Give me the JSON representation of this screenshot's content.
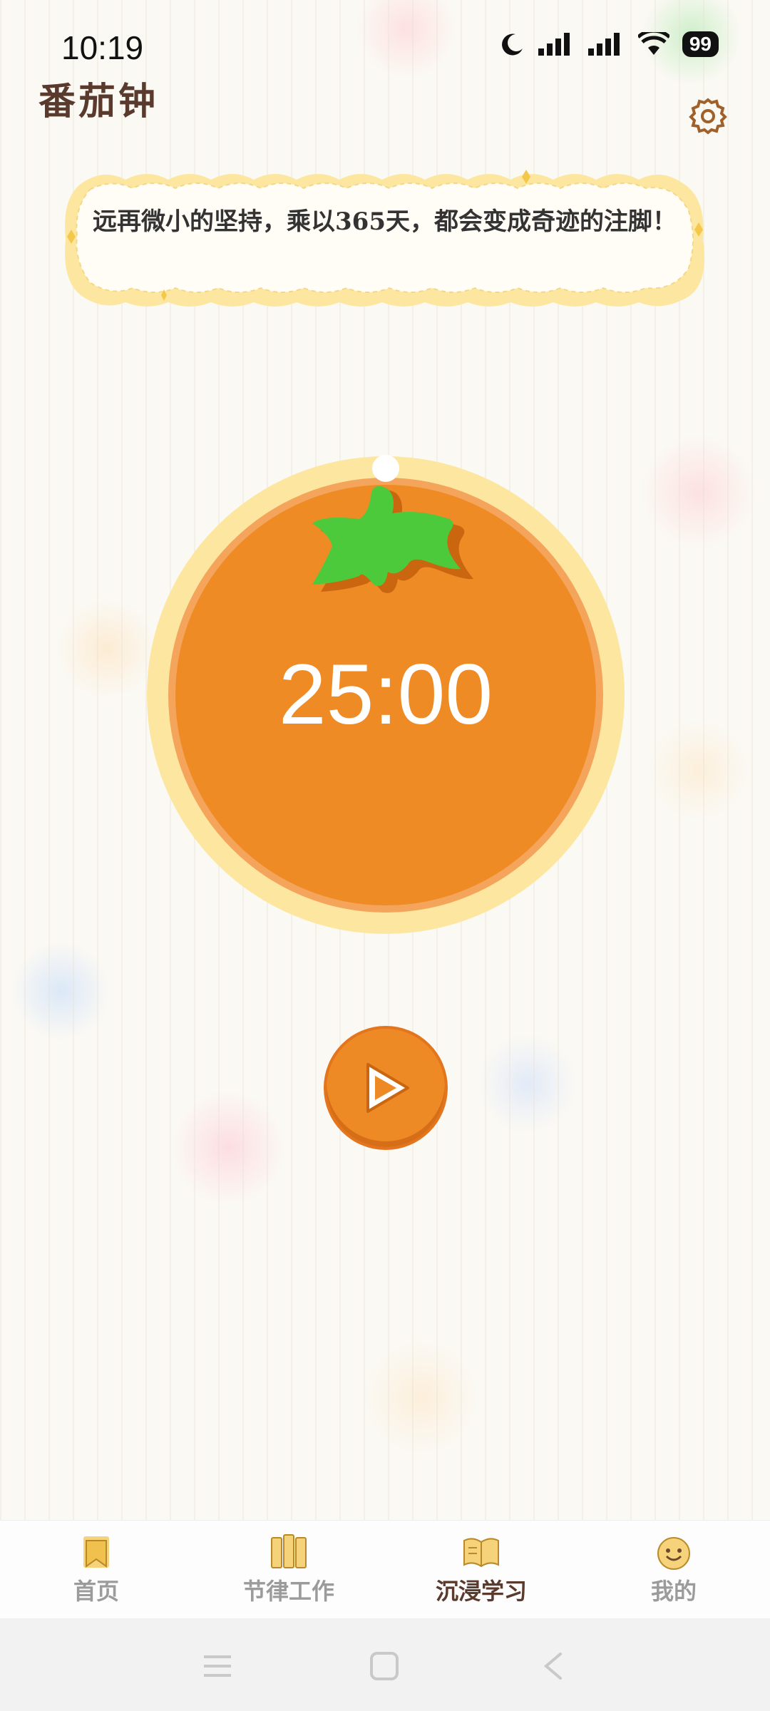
{
  "status_bar": {
    "time": "10:19",
    "battery": "99"
  },
  "header": {
    "title": "番茄钟",
    "settings_icon": "gear-icon"
  },
  "quote": {
    "text": "远再微小的坚持，乘以365天，都会变成奇迹的注脚！"
  },
  "timer": {
    "display": "25:00",
    "progress": 0
  },
  "controls": {
    "play_icon": "play-icon"
  },
  "tabs": [
    {
      "label": "首页",
      "icon": "bookmark-icon",
      "active": false
    },
    {
      "label": "节律工作",
      "icon": "books-icon",
      "active": false
    },
    {
      "label": "沉浸学习",
      "icon": "open-book-icon",
      "active": true
    },
    {
      "label": "我的",
      "icon": "smiley-icon",
      "active": false
    }
  ],
  "colors": {
    "tomato": "#ef8b25",
    "ring": "#fde7a0",
    "leaf": "#4dca3c",
    "accent_text": "#5a3a2c"
  }
}
